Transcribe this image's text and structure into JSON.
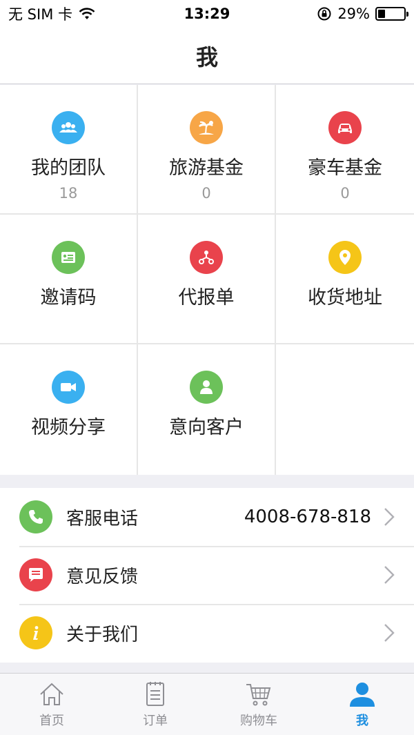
{
  "status_bar": {
    "carrier": "无 SIM 卡",
    "time": "13:29",
    "battery": "29%",
    "battery_level": 0.29
  },
  "header": {
    "title": "我"
  },
  "grid": [
    {
      "label": "我的团队",
      "count": "18",
      "icon": "team-icon",
      "color": "#3ab0f0"
    },
    {
      "label": "旅游基金",
      "count": "0",
      "icon": "palm-beach-icon",
      "color": "#f7a647"
    },
    {
      "label": "豪车基金",
      "count": "0",
      "icon": "car-icon",
      "color": "#e9434c"
    },
    {
      "label": "邀请码",
      "icon": "invite-card-icon",
      "color": "#6cc15a"
    },
    {
      "label": "代报单",
      "icon": "share-node-icon",
      "color": "#e9434c"
    },
    {
      "label": "收货地址",
      "icon": "location-pin-icon",
      "color": "#f5c518"
    },
    {
      "label": "视频分享",
      "icon": "video-camera-icon",
      "color": "#3ab0f0"
    },
    {
      "label": "意向客户",
      "icon": "user-icon",
      "color": "#6cc15a"
    }
  ],
  "list": [
    {
      "label": "客服电话",
      "value": "4008-678-818",
      "icon": "phone-icon",
      "color": "#6cc15a"
    },
    {
      "label": "意见反馈",
      "icon": "message-icon",
      "color": "#e9434c"
    },
    {
      "label": "关于我们",
      "icon": "info-icon",
      "color": "#f5c518"
    }
  ],
  "tabs": [
    {
      "label": "首页",
      "icon": "home-icon",
      "active": false
    },
    {
      "label": "订单",
      "icon": "order-list-icon",
      "active": false
    },
    {
      "label": "购物车",
      "icon": "cart-icon",
      "active": false
    },
    {
      "label": "我",
      "icon": "profile-icon",
      "active": true
    }
  ],
  "colors": {
    "active_tab": "#1e8fe0",
    "inactive_tab": "#8e8e93"
  }
}
